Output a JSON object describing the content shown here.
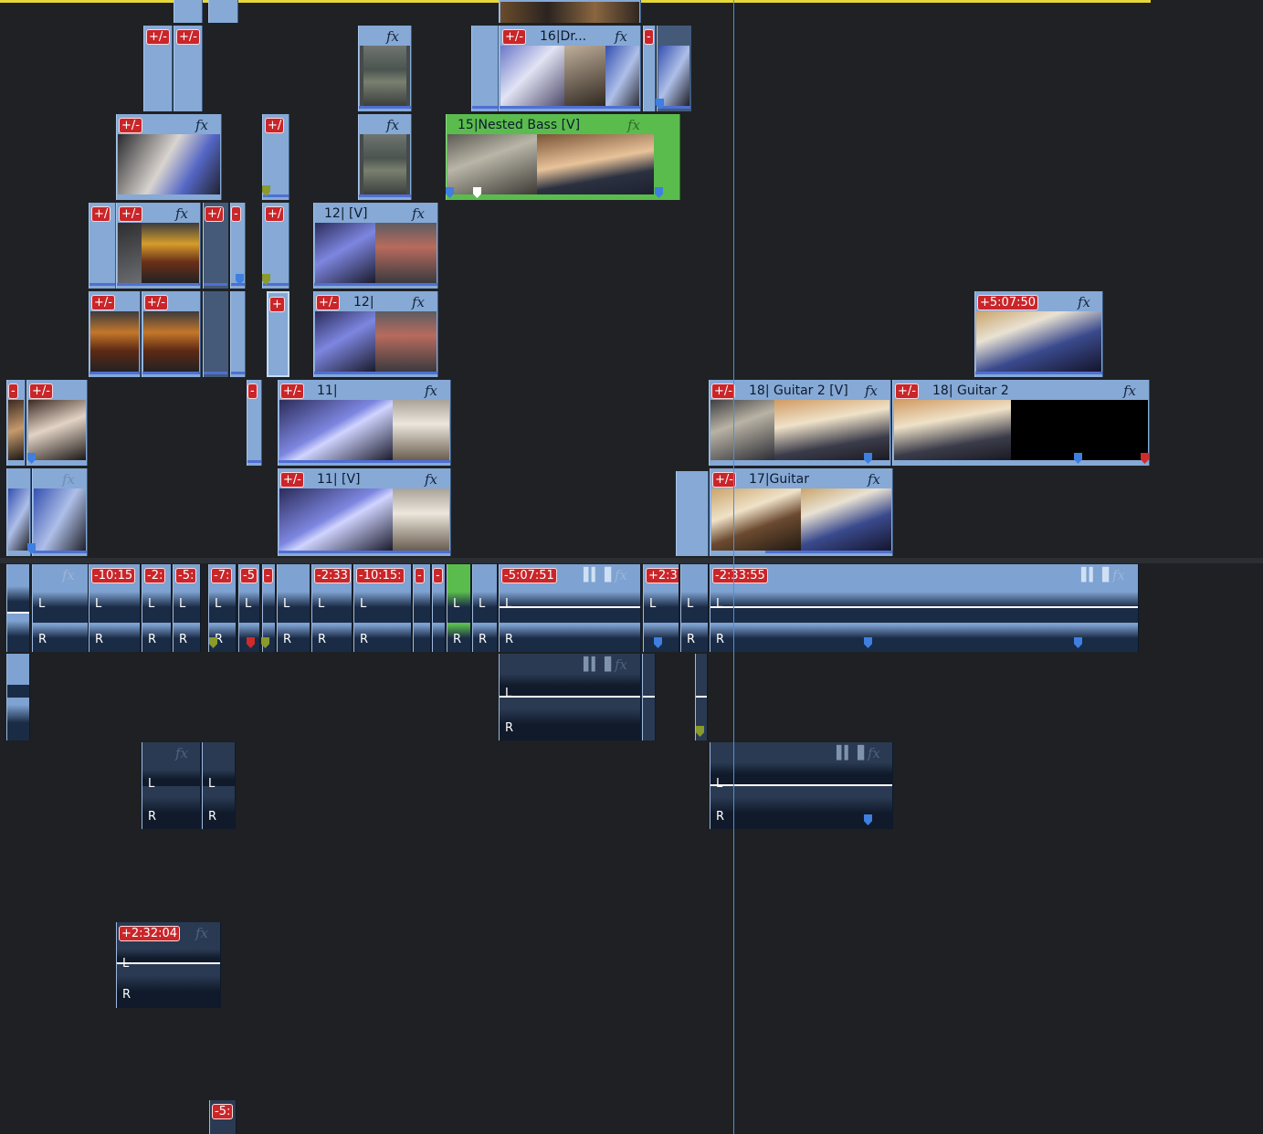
{
  "timeline": {
    "colors": {
      "clip": "#86a9d6",
      "nested_clip": "#5bbc4e",
      "badge": "#c9262a",
      "playhead": "#4b8fe5",
      "work_area": "#e7d83a",
      "marker_blue": "#3e7fe0",
      "marker_red": "#d12a2a",
      "marker_olive": "#8a9a2c",
      "marker_white": "#ffffff"
    },
    "fx_label": "fx",
    "wave_icon": "waveform-icon",
    "channel_left": "L",
    "channel_right": "R",
    "clips": {
      "drums": "16|Dr...",
      "nested_bass": "15|Nested Bass [V]",
      "v12a": "12| [V]",
      "v12b": "12|",
      "v11a": "11|",
      "v11b": "11| [V]",
      "guitar2v": "18| Guitar 2 [V]",
      "guitar2": "18| Guitar 2",
      "guitar17": "17|Guitar"
    },
    "badges": {
      "pm": "+/-",
      "pm_short": "+/",
      "plus": "+",
      "trim": "-",
      "offset_507_50": "+5:07:50",
      "a_10_15": "-10:15",
      "a_2": "-2:",
      "a_5": "-5:",
      "a_7": "-7:",
      "a_s": "-5",
      "a_2_33": "-2:33",
      "a_10_15b": "-10:15:",
      "a_5_07_51": "-5:07:51",
      "a_2_3": "+2:3",
      "a_2_33_55": "-2:33:55",
      "a_2_32_04": "+2:32:04",
      "a_5_bottom": "-5:"
    }
  }
}
